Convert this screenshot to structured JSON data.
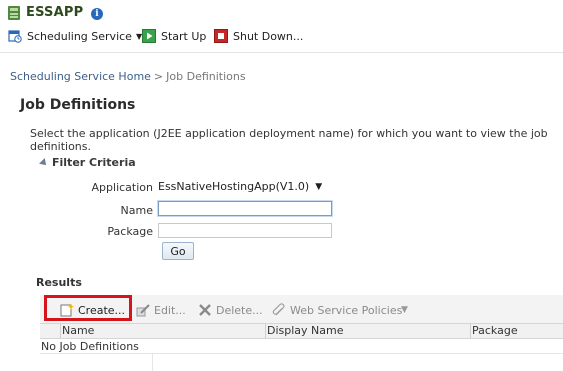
{
  "header": {
    "app_title": "ESSAPP",
    "info_icon": "info-icon",
    "info_glyph": "i"
  },
  "toolbar": {
    "scheduling_service_label": "Scheduling Service",
    "start_up_label": "Start Up",
    "shut_down_label": "Shut Down..."
  },
  "breadcrumb": {
    "home": "Scheduling Service Home",
    "separator": ">",
    "current": "Job Definitions"
  },
  "page": {
    "title": "Job Definitions",
    "instructions": "Select the application (J2EE application deployment name) for which you want to view the job definitions."
  },
  "filter": {
    "section_label": "Filter Criteria",
    "application_label": "Application",
    "application_value": "EssNativeHostingApp(V1.0)",
    "name_label": "Name",
    "name_value": "",
    "package_label": "Package",
    "package_value": "",
    "go_label": "Go"
  },
  "results": {
    "section_label": "Results",
    "create_label": "Create...",
    "edit_label": "Edit...",
    "delete_label": "Delete...",
    "web_service_policies_label": "Web Service Policies",
    "columns": [
      "Name",
      "Display Name",
      "Package"
    ],
    "empty_message": "No Job Definitions"
  },
  "colors": {
    "accent_blue": "#3b5f8a",
    "highlight_red": "#d6141c",
    "start_green": "#3aa34a",
    "shutdown_red": "#c62828"
  }
}
